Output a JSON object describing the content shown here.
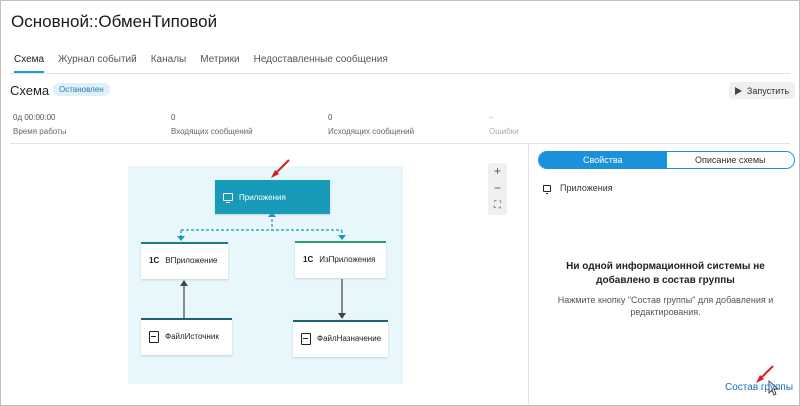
{
  "window": {
    "title": "Основной::ОбменТиповой"
  },
  "tabs": [
    {
      "label": "Схема"
    },
    {
      "label": "Журнал событий"
    },
    {
      "label": "Каналы"
    },
    {
      "label": "Метрики"
    },
    {
      "label": "Недоставленные сообщения"
    }
  ],
  "schema": {
    "title": "Схема",
    "status": "Остановлен",
    "run_label": "Запустить"
  },
  "stats": [
    {
      "value": "0д 00:00:00",
      "label": "Время работы"
    },
    {
      "value": "0",
      "label": "Входящих сообщений"
    },
    {
      "value": "0",
      "label": "Исходящих сообщений"
    },
    {
      "value": "–",
      "label": "Ошибки"
    }
  ],
  "zoom": {
    "plus": "+",
    "minus": "−",
    "fit": "⛶"
  },
  "nodes": {
    "apps": "Приложения",
    "to_app": "ВПриложение",
    "from_app": "ИзПриложения",
    "file_source": "ФайлИсточник",
    "file_dest": "ФайлНазначение",
    "db_badge": "1С"
  },
  "panel": {
    "tab_properties": "Свойства",
    "tab_description": "Описание схемы",
    "item_label": "Приложения",
    "empty_title": "Ни одной информационной системы не добавлено в состав группы",
    "empty_text": "Нажмите кнопку \"Состав группы\" для добавления и редактирования.",
    "group_button": "Состав группы"
  },
  "colors": {
    "accent": "#1a92d9",
    "node_main": "#179bb8",
    "canvas_bg": "#e8f7fb",
    "node_topbar_left": "#1f7c8f",
    "node_topbar_right": "#2aa06a",
    "node_topbar_bottom": "#1f5f7a",
    "annotation_arrow": "#d42020"
  }
}
